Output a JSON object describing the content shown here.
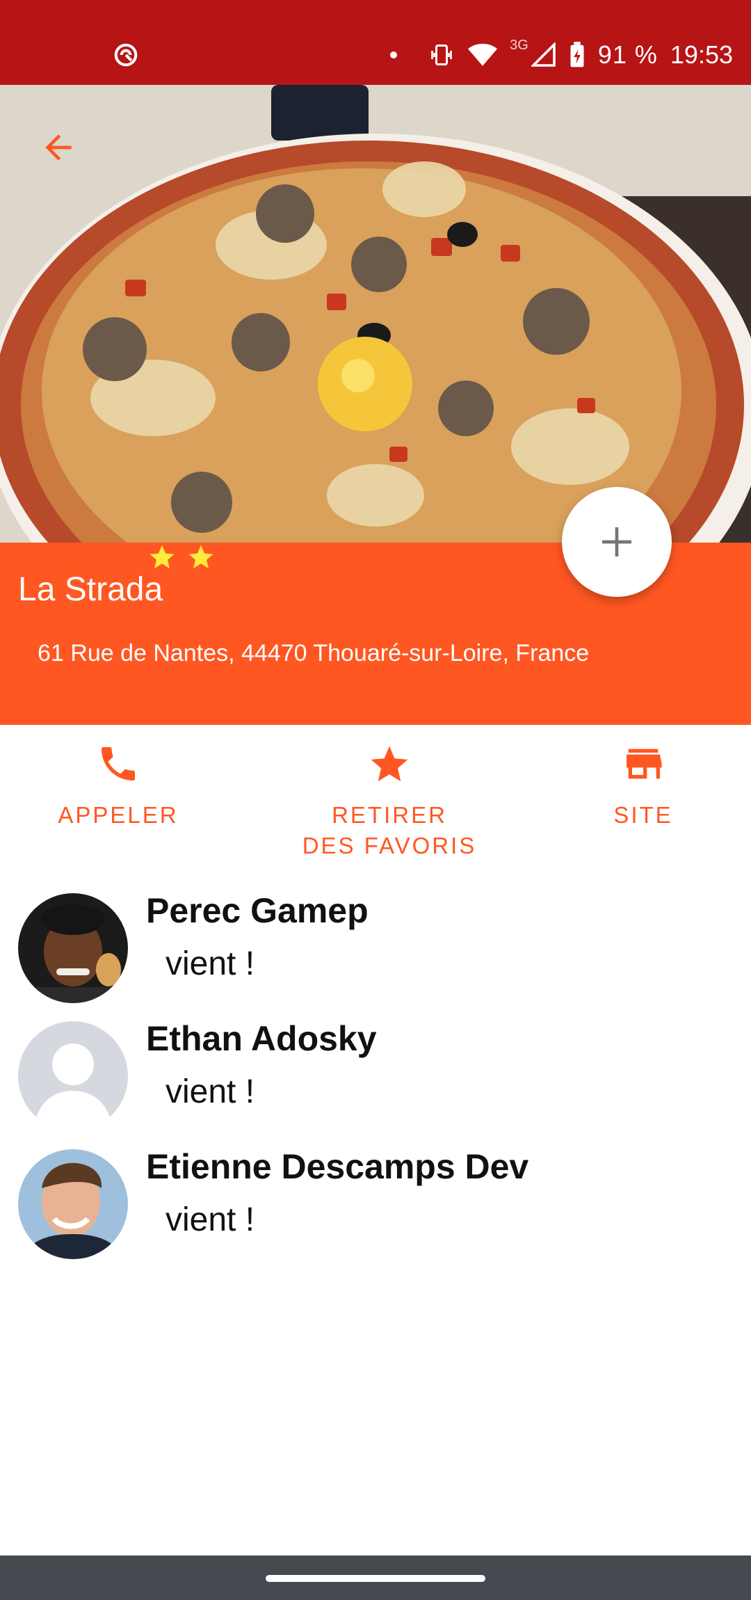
{
  "status_bar": {
    "network_type": "3G",
    "battery": "91 %",
    "time": "19:53",
    "background": "#b71416"
  },
  "restaurant": {
    "rating": 2,
    "name": "La Strada",
    "address": "61 Rue de Nantes, 44470 Thouaré-sur-Loire, France"
  },
  "actions": {
    "call_label": "APPELER",
    "favorite_label_line1": "RETIRER",
    "favorite_label_line2": "DES FAVORIS",
    "site_label": "SITE"
  },
  "attendees": [
    {
      "name": "Perec Gamep",
      "status": "vient !"
    },
    {
      "name": "Ethan Adosky",
      "status": "vient !"
    },
    {
      "name": "Etienne Descamps Dev",
      "status": "vient !"
    }
  ],
  "colors": {
    "accent": "#ff5722",
    "star": "#ffeb3b",
    "nav_bar": "#444a50"
  },
  "icons": {
    "back": "arrow-back-icon",
    "add": "plus-icon",
    "call": "phone-icon",
    "favorite": "star-icon",
    "site": "store-icon"
  }
}
